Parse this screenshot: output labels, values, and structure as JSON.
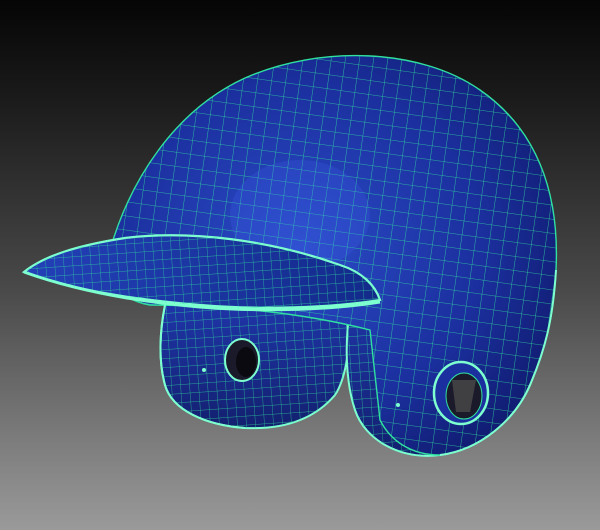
{
  "scene": {
    "subject": "wireframe-baseball-batting-helmet",
    "colors": {
      "background_top": "#050505",
      "background_bottom": "#9a9a9a",
      "shell_light": "#2b4cc8",
      "shell_mid": "#1b2f9e",
      "shell_dark": "#0c145c",
      "wire": "#2fe0a0",
      "rim": "#7dffd0",
      "inner": "#1a1a2a"
    }
  }
}
